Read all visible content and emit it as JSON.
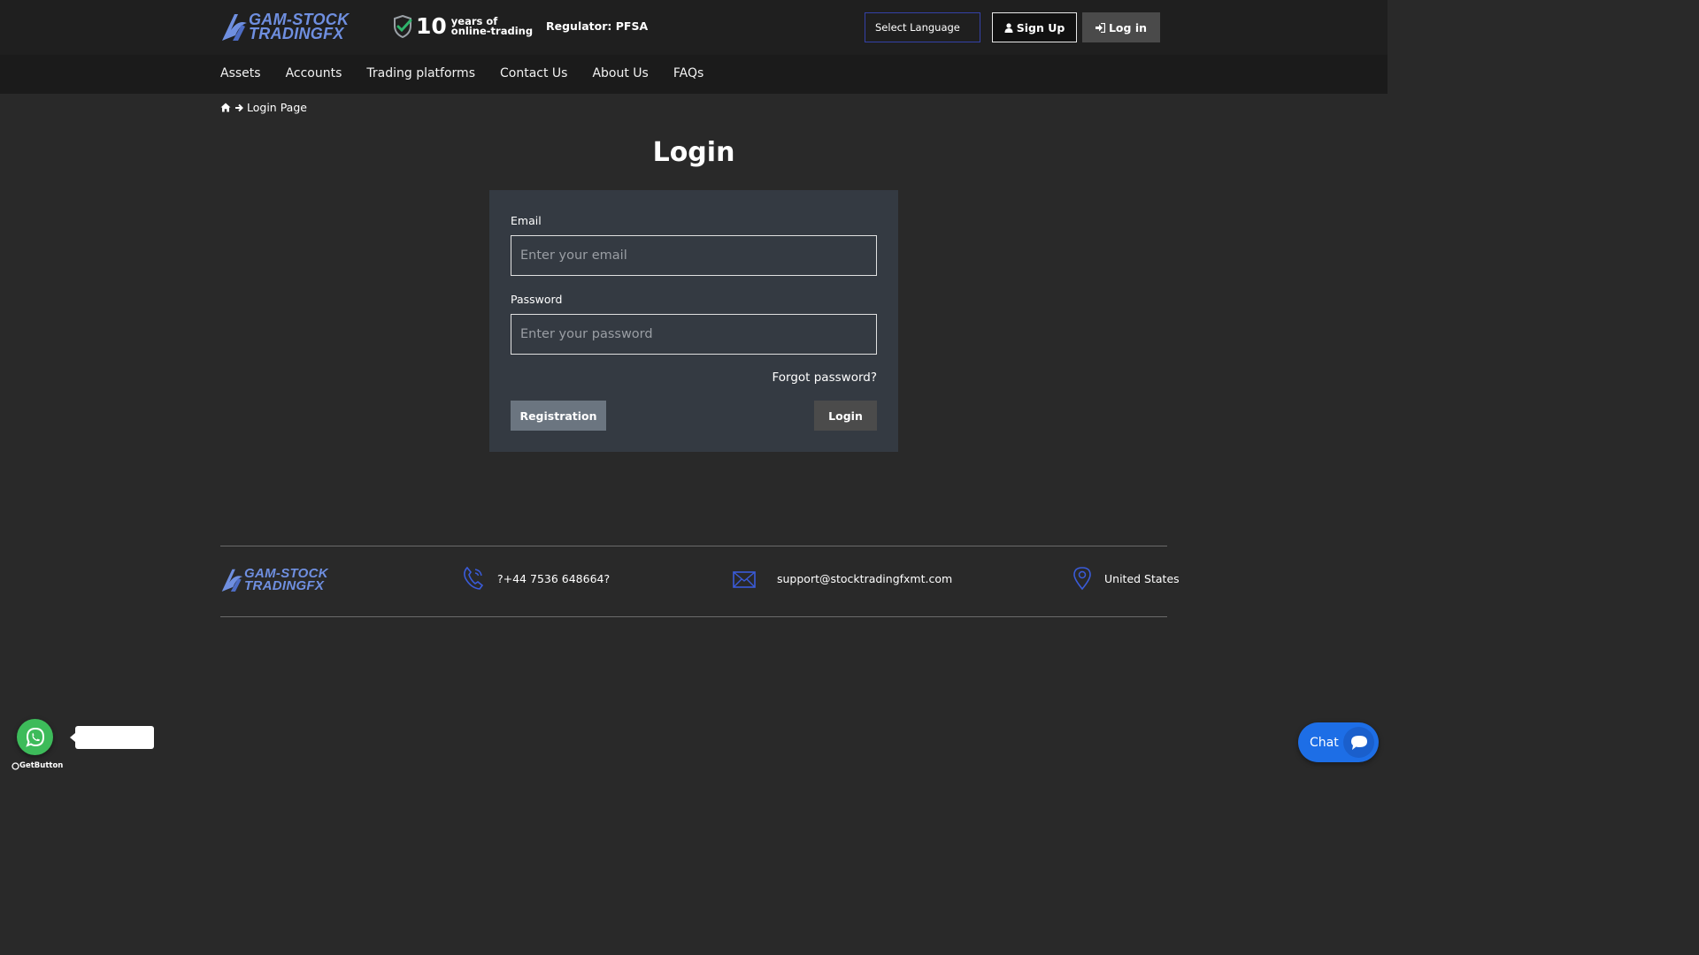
{
  "header": {
    "logo": {
      "line1": "GAM-STOCK",
      "line2": "TRADINGFX"
    },
    "experience": {
      "number": "10",
      "line1": "years of",
      "line2": "online-trading"
    },
    "regulator": "Regulator: PFSA",
    "language_select": "Select Language",
    "signup_label": "Sign Up",
    "login_label": "Log in"
  },
  "nav": {
    "items": [
      {
        "label": "Assets"
      },
      {
        "label": "Accounts"
      },
      {
        "label": "Trading platforms"
      },
      {
        "label": "Contact Us"
      },
      {
        "label": "About Us"
      },
      {
        "label": "FAQs"
      }
    ]
  },
  "breadcrumb": {
    "current": "Login Page"
  },
  "page_title": "Login",
  "form": {
    "email_label": "Email",
    "email_placeholder": "Enter your email",
    "email_value": "",
    "password_label": "Password",
    "password_placeholder": "Enter your password",
    "password_value": "",
    "forgot_label": "Forgot password?",
    "registration_label": "Registration",
    "login_label": "Login"
  },
  "footer": {
    "logo": {
      "line1": "GAM-STOCK",
      "line2": "TRADINGFX"
    },
    "phone": "?+44 7536 648664?",
    "email": "support@stocktradingfxmt.com",
    "location": "United States"
  },
  "widgets": {
    "getbutton_label": "GetButton",
    "chat_label": "Chat"
  },
  "colors": {
    "accent_blue": "#6f8fe0",
    "chat_blue": "#1d6ee6",
    "whatsapp_green": "#3dbb5a"
  },
  "icons": [
    "logo-mark-icon",
    "shield-check-icon",
    "user-icon",
    "sign-in-icon",
    "home-icon",
    "arrow-right-icon",
    "phone-icon",
    "envelope-icon",
    "map-pin-icon",
    "whatsapp-icon",
    "chat-bubble-icon"
  ]
}
